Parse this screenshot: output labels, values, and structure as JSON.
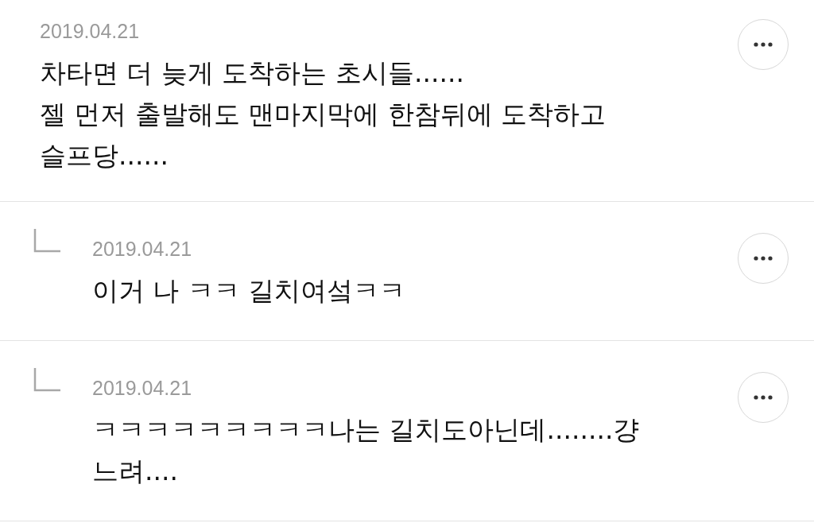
{
  "comments": [
    {
      "kind": "comment",
      "date": "2019.04.21",
      "lines": [
        "차타면 더 늦게 도착하는 초시들......",
        "젤 먼저 출발해도 맨마지막에 한참뒤에 도착하고",
        "슬프당......"
      ]
    },
    {
      "kind": "reply",
      "date": "2019.04.21",
      "lines": [
        "이거 나 ㅋㅋ 길치여섴ㅋㅋ"
      ]
    },
    {
      "kind": "reply",
      "date": "2019.04.21",
      "lines": [
        "ㅋㅋㅋㅋㅋㅋㅋㅋㅋ나는 길치도아닌데........걍",
        "느려...."
      ]
    }
  ]
}
